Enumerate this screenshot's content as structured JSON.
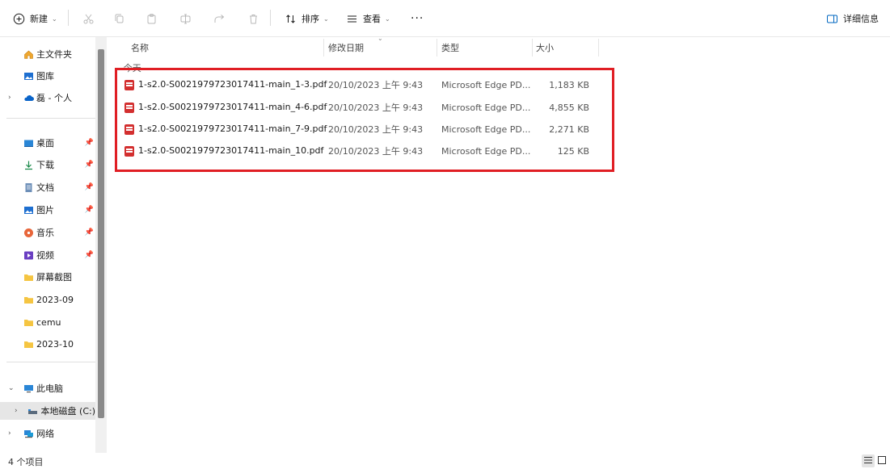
{
  "toolbar": {
    "new_label": "新建",
    "sort_label": "排序",
    "view_label": "查看",
    "more_label": "···",
    "details_label": "详细信息"
  },
  "sidebar": {
    "items": [
      {
        "label": "主文件夹"
      },
      {
        "label": "图库"
      },
      {
        "label": "磊 - 个人"
      },
      {
        "label": "桌面"
      },
      {
        "label": "下载"
      },
      {
        "label": "文档"
      },
      {
        "label": "图片"
      },
      {
        "label": "音乐"
      },
      {
        "label": "视频"
      },
      {
        "label": "屏幕截图"
      },
      {
        "label": "2023-09"
      },
      {
        "label": "cemu"
      },
      {
        "label": "2023-10"
      },
      {
        "label": "此电脑"
      },
      {
        "label": "本地磁盘 (C:)"
      },
      {
        "label": "网络"
      }
    ]
  },
  "columns": {
    "name": "名称",
    "date": "修改日期",
    "type": "类型",
    "size": "大小"
  },
  "group": {
    "label": "今天"
  },
  "files": [
    {
      "name": "1-s2.0-S0021979723017411-main_1-3.pdf",
      "date": "20/10/2023 上午 9:43",
      "type": "Microsoft Edge PD...",
      "size": "1,183 KB"
    },
    {
      "name": "1-s2.0-S0021979723017411-main_4-6.pdf",
      "date": "20/10/2023 上午 9:43",
      "type": "Microsoft Edge PD...",
      "size": "4,855 KB"
    },
    {
      "name": "1-s2.0-S0021979723017411-main_7-9.pdf",
      "date": "20/10/2023 上午 9:43",
      "type": "Microsoft Edge PD...",
      "size": "2,271 KB"
    },
    {
      "name": "1-s2.0-S0021979723017411-main_10.pdf",
      "date": "20/10/2023 上午 9:43",
      "type": "Microsoft Edge PD...",
      "size": "125 KB"
    }
  ],
  "status": {
    "item_count": "4 个项目"
  },
  "colors": {
    "highlight": "#e01e24",
    "pdf": "#d32f2f",
    "accent": "#0067c0"
  }
}
